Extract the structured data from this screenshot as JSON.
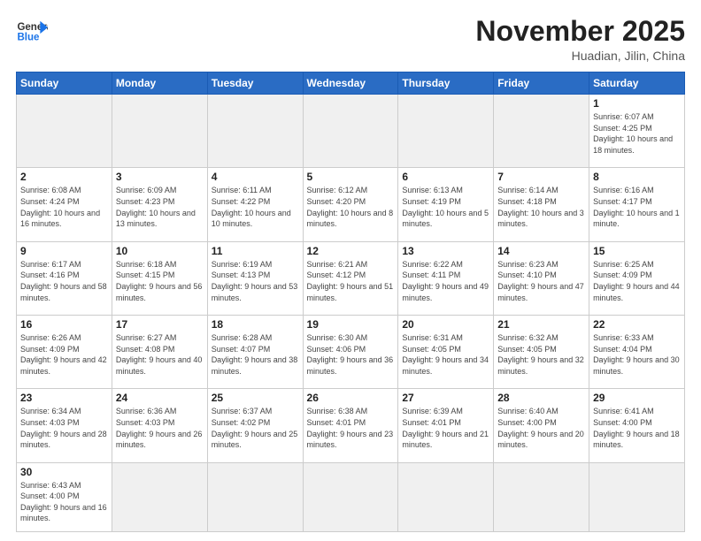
{
  "header": {
    "logo_general": "General",
    "logo_blue": "Blue",
    "month_title": "November 2025",
    "location": "Huadian, Jilin, China"
  },
  "weekdays": [
    "Sunday",
    "Monday",
    "Tuesday",
    "Wednesday",
    "Thursday",
    "Friday",
    "Saturday"
  ],
  "days": {
    "1": {
      "sunrise": "6:07 AM",
      "sunset": "4:25 PM",
      "daylight": "10 hours and 18 minutes."
    },
    "2": {
      "sunrise": "6:08 AM",
      "sunset": "4:24 PM",
      "daylight": "10 hours and 16 minutes."
    },
    "3": {
      "sunrise": "6:09 AM",
      "sunset": "4:23 PM",
      "daylight": "10 hours and 13 minutes."
    },
    "4": {
      "sunrise": "6:11 AM",
      "sunset": "4:22 PM",
      "daylight": "10 hours and 10 minutes."
    },
    "5": {
      "sunrise": "6:12 AM",
      "sunset": "4:20 PM",
      "daylight": "10 hours and 8 minutes."
    },
    "6": {
      "sunrise": "6:13 AM",
      "sunset": "4:19 PM",
      "daylight": "10 hours and 5 minutes."
    },
    "7": {
      "sunrise": "6:14 AM",
      "sunset": "4:18 PM",
      "daylight": "10 hours and 3 minutes."
    },
    "8": {
      "sunrise": "6:16 AM",
      "sunset": "4:17 PM",
      "daylight": "10 hours and 1 minute."
    },
    "9": {
      "sunrise": "6:17 AM",
      "sunset": "4:16 PM",
      "daylight": "9 hours and 58 minutes."
    },
    "10": {
      "sunrise": "6:18 AM",
      "sunset": "4:15 PM",
      "daylight": "9 hours and 56 minutes."
    },
    "11": {
      "sunrise": "6:19 AM",
      "sunset": "4:13 PM",
      "daylight": "9 hours and 53 minutes."
    },
    "12": {
      "sunrise": "6:21 AM",
      "sunset": "4:12 PM",
      "daylight": "9 hours and 51 minutes."
    },
    "13": {
      "sunrise": "6:22 AM",
      "sunset": "4:11 PM",
      "daylight": "9 hours and 49 minutes."
    },
    "14": {
      "sunrise": "6:23 AM",
      "sunset": "4:10 PM",
      "daylight": "9 hours and 47 minutes."
    },
    "15": {
      "sunrise": "6:25 AM",
      "sunset": "4:09 PM",
      "daylight": "9 hours and 44 minutes."
    },
    "16": {
      "sunrise": "6:26 AM",
      "sunset": "4:09 PM",
      "daylight": "9 hours and 42 minutes."
    },
    "17": {
      "sunrise": "6:27 AM",
      "sunset": "4:08 PM",
      "daylight": "9 hours and 40 minutes."
    },
    "18": {
      "sunrise": "6:28 AM",
      "sunset": "4:07 PM",
      "daylight": "9 hours and 38 minutes."
    },
    "19": {
      "sunrise": "6:30 AM",
      "sunset": "4:06 PM",
      "daylight": "9 hours and 36 minutes."
    },
    "20": {
      "sunrise": "6:31 AM",
      "sunset": "4:05 PM",
      "daylight": "9 hours and 34 minutes."
    },
    "21": {
      "sunrise": "6:32 AM",
      "sunset": "4:05 PM",
      "daylight": "9 hours and 32 minutes."
    },
    "22": {
      "sunrise": "6:33 AM",
      "sunset": "4:04 PM",
      "daylight": "9 hours and 30 minutes."
    },
    "23": {
      "sunrise": "6:34 AM",
      "sunset": "4:03 PM",
      "daylight": "9 hours and 28 minutes."
    },
    "24": {
      "sunrise": "6:36 AM",
      "sunset": "4:03 PM",
      "daylight": "9 hours and 26 minutes."
    },
    "25": {
      "sunrise": "6:37 AM",
      "sunset": "4:02 PM",
      "daylight": "9 hours and 25 minutes."
    },
    "26": {
      "sunrise": "6:38 AM",
      "sunset": "4:01 PM",
      "daylight": "9 hours and 23 minutes."
    },
    "27": {
      "sunrise": "6:39 AM",
      "sunset": "4:01 PM",
      "daylight": "9 hours and 21 minutes."
    },
    "28": {
      "sunrise": "6:40 AM",
      "sunset": "4:00 PM",
      "daylight": "9 hours and 20 minutes."
    },
    "29": {
      "sunrise": "6:41 AM",
      "sunset": "4:00 PM",
      "daylight": "9 hours and 18 minutes."
    },
    "30": {
      "sunrise": "6:43 AM",
      "sunset": "4:00 PM",
      "daylight": "9 hours and 16 minutes."
    }
  }
}
